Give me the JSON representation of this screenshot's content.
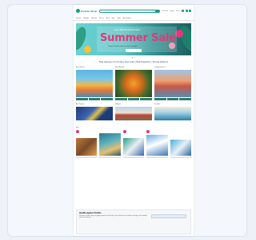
{
  "header": {
    "logo_text": "Puzzle Shop",
    "search_placeholder": "",
    "links": [
      "Service",
      "Login",
      "Cart"
    ],
    "nav_items": [
      "Puzzles",
      "Brands",
      "Themes",
      "Pieces",
      "New",
      "Sale",
      "Gifts",
      "Accessories"
    ]
  },
  "hero": {
    "kicker": "Up to 50% off selected items",
    "title": "Summer Sale",
    "subtitle": "Shop the best puzzles of the season",
    "cta": "Shop now"
  },
  "tagline": "Free Delivery On Orders Over £40 | Fast Dispatch | 30 Day Returns",
  "features": [
    {
      "label": "Best Sellers",
      "image": "beach-scene"
    },
    {
      "label": "New Arrivals",
      "image": "tiger-painting"
    },
    {
      "label": "Coastal Scenes",
      "image": "coastal-town"
    }
  ],
  "features_small": [
    {
      "label": "Art Classics",
      "image": "starry-night"
    },
    {
      "label": "Villages",
      "image": "village"
    },
    {
      "label": "Seaside",
      "image": "seaside"
    }
  ],
  "products_label": "Sale",
  "footer": {
    "title": "Quality Jigsaw Puzzles",
    "body": "Discover a wide range of jigsaw puzzles for all ages, from classic art to modern designs, all available with fast delivery.",
    "button": "Sign up"
  },
  "colors": {
    "brand": "#1a9c8a",
    "accent": "#e2387c",
    "button": "#2d7b6f"
  }
}
